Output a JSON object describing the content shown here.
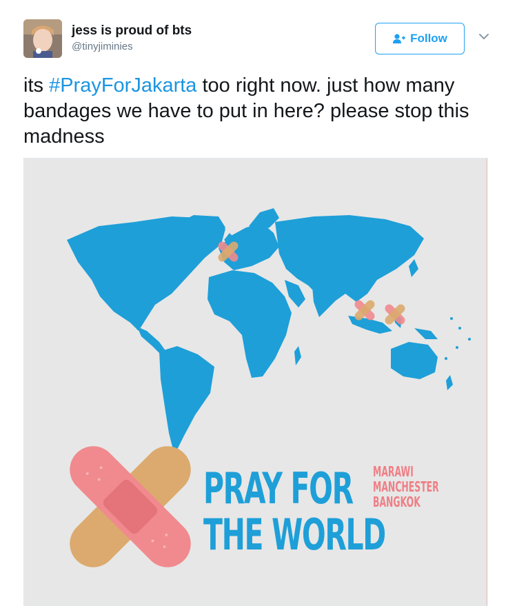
{
  "tweet": {
    "display_name": "jess is proud of bts",
    "handle": "@tinyjiminies",
    "follow_label": "Follow",
    "text_before": "its ",
    "hashtag": "#PrayForJakarta",
    "text_after": " too right now. just how many bandages we have to put in here? please stop this madness"
  },
  "image": {
    "title_line1": "PRAY FOR",
    "title_line2": "THE WORLD",
    "cities": [
      "MARAWI",
      "MANCHESTER",
      "BANGKOK"
    ]
  },
  "colors": {
    "accent": "#1da1f2",
    "hashtag": "#1b95e0",
    "map_blue": "#1e9fd8",
    "bandage_pink": "#f08a8e",
    "bandage_tan": "#dcaa6e",
    "image_bg": "#e7e7e7"
  },
  "icons": {
    "follow": "add-user-icon",
    "menu": "chevron-down-icon"
  }
}
